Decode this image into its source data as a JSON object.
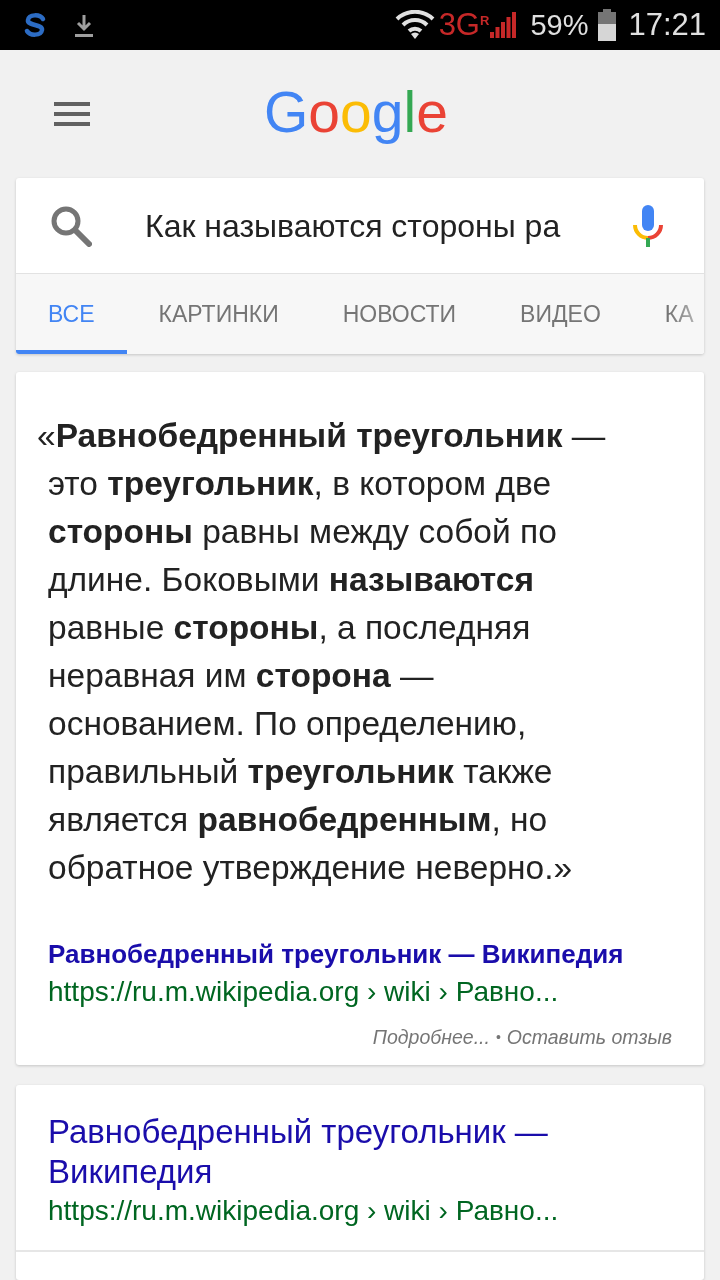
{
  "status_bar": {
    "network": "3G",
    "roaming": "R",
    "battery": "59%",
    "time": "17:21"
  },
  "header": {
    "logo": "Google"
  },
  "search": {
    "query": "Как называются стороны ра"
  },
  "tabs": [
    {
      "label": "ВСЕ",
      "selected": true
    },
    {
      "label": "КАРТИНКИ",
      "selected": false
    },
    {
      "label": "НОВОСТИ",
      "selected": false
    },
    {
      "label": "ВИДЕО",
      "selected": false
    },
    {
      "label": "КА",
      "selected": false
    }
  ],
  "results": [
    {
      "kind": "featured",
      "snippet": "«**Равнобедренный треугольник** — это **треугольник**, в котором две **стороны** равны между собой по длине. Боковыми **называются** равные **стороны**, а последняя неравная им **сторона** — основанием. По определению, правильный **треугольник** также является **равнобедренным**, но обратное утверждение неверно.»",
      "title": "Равнобедренный треугольник — Википедия",
      "url": "https://ru.m.wikipedia.org › wiki › Равно...",
      "actions": [
        "Подробнее...",
        "Оставить отзыв"
      ],
      "separator": "•"
    },
    {
      "kind": "web",
      "title": "Равнобедренный треугольник — Википедия",
      "url": "https://ru.m.wikipedia.org › wiki › Равно..."
    }
  ]
}
